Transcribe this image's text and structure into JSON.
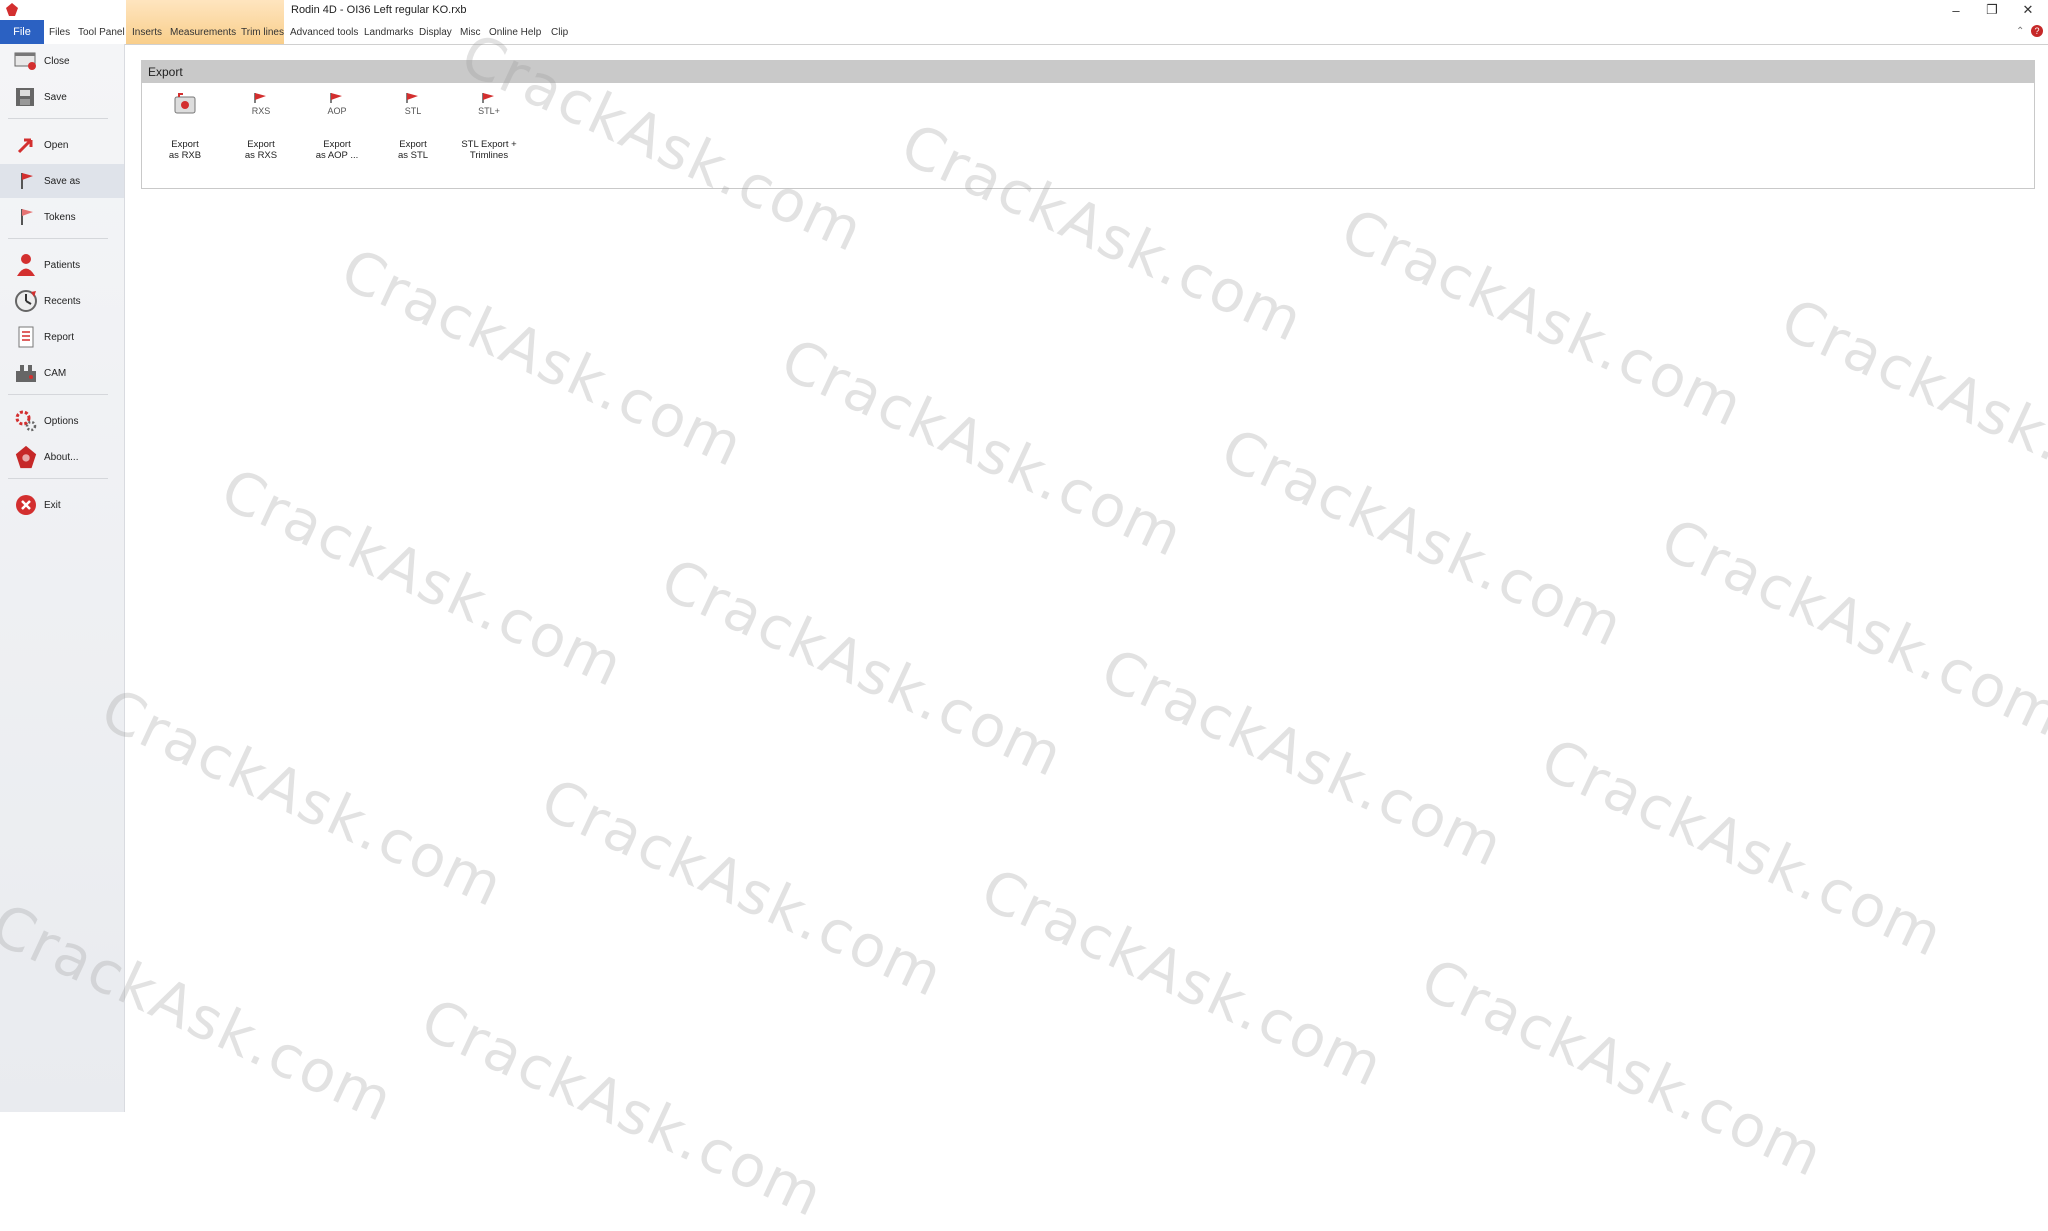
{
  "window": {
    "title": "Rodin 4D - OI36 Left regular KO.rxb",
    "minimize": "–",
    "maximize": "❐",
    "close": "✕"
  },
  "menu": {
    "tabs": [
      "File",
      "Files",
      "Tool Panel",
      "Inserts",
      "Measurements",
      "Trim lines",
      "Advanced tools",
      "Landmarks",
      "Display",
      "Misc",
      "Online Help",
      "Clip"
    ],
    "help_symbol": "?",
    "collapse_symbol": "⌃"
  },
  "sidebar": {
    "items": [
      {
        "label": "Close",
        "icon": "close-file-icon"
      },
      {
        "label": "Save",
        "icon": "save-icon"
      },
      {
        "label": "Open",
        "icon": "open-icon"
      },
      {
        "label": "Save as",
        "icon": "save-as-icon"
      },
      {
        "label": "Tokens",
        "icon": "tokens-icon"
      },
      {
        "label": "Patients",
        "icon": "patients-icon"
      },
      {
        "label": "Recents",
        "icon": "recents-icon"
      },
      {
        "label": "Report",
        "icon": "report-icon"
      },
      {
        "label": "CAM",
        "icon": "cam-icon"
      },
      {
        "label": "Options",
        "icon": "options-icon"
      },
      {
        "label": "About...",
        "icon": "about-icon"
      },
      {
        "label": "Exit",
        "icon": "exit-icon"
      }
    ],
    "selected": "Save as"
  },
  "export": {
    "title": "Export",
    "buttons": [
      {
        "line1": "Export",
        "line2": "as RXB",
        "icon": "export-rxb-icon",
        "icon_text": ""
      },
      {
        "line1": "Export",
        "line2": "as RXS",
        "icon": "export-rxs-icon",
        "icon_text": "RXS"
      },
      {
        "line1": "Export",
        "line2": "as AOP ...",
        "icon": "export-aop-icon",
        "icon_text": "AOP"
      },
      {
        "line1": "Export",
        "line2": "as STL",
        "icon": "export-stl-icon",
        "icon_text": "STL"
      },
      {
        "line1": "STL Export +",
        "line2": "Trimlines",
        "icon": "stl-trimlines-icon",
        "icon_text": "STL+"
      }
    ]
  },
  "watermark": "CrackAsk.com",
  "colors": {
    "file_tab": "#2b61c2",
    "accent_red": "#d32f2f",
    "tab_highlight": "#f8c97e"
  }
}
